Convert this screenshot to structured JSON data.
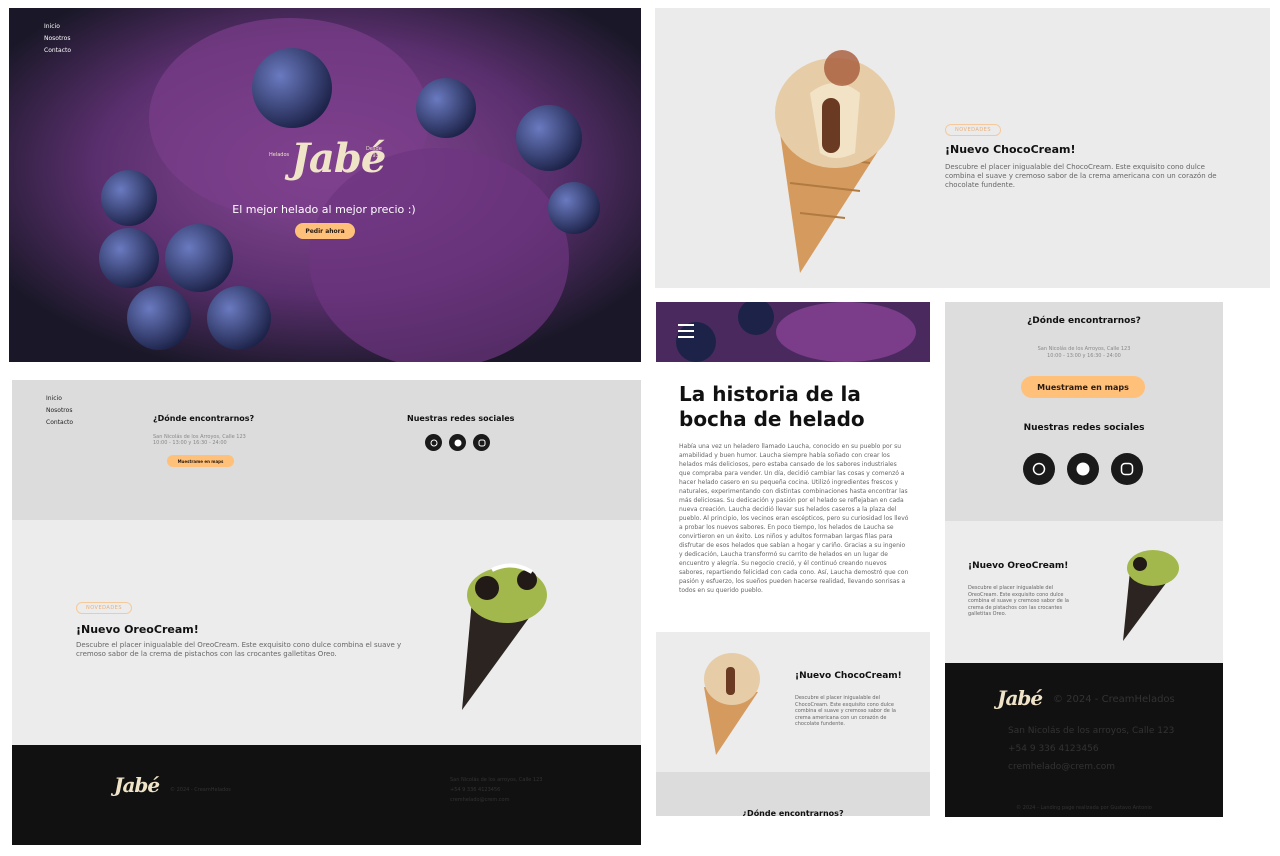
{
  "nav": {
    "inicio": "Inicio",
    "nosotros": "Nosotros",
    "contacto": "Contacto"
  },
  "hero": {
    "logo_left": "Helados",
    "logo": "Jabé",
    "logo_right_1": "Desde",
    "logo_right_2": "1993",
    "tagline": "El mejor helado al mejor precio :)",
    "cta": "Pedir ahora"
  },
  "choco": {
    "badge": "NOVEDADES",
    "title": "¡Nuevo ChocoCream!",
    "desc": "Descubre el placer inigualable del ChocoCream. Este exquisito cono dulce combina el suave y cremoso sabor de la crema americana con un corazón de chocolate fundente."
  },
  "oreo": {
    "badge": "NOVEDADES",
    "title": "¡Nuevo OreoCream!",
    "desc": "Descubre el placer inigualable del OreoCream. Este exquisito cono dulce combina el suave y cremoso sabor de la crema de pistachos con las crocantes galletitas Oreo."
  },
  "location": {
    "title": "¿Dónde encontrarnos?",
    "address": "San Nicolás de los Arroyos, Calle 123",
    "hours": "10:00 - 13:00 y 16:30 - 24:00",
    "button": "Muestrame en maps",
    "button_small": "Muestrame en maps"
  },
  "social": {
    "title": "Nuestras redes sociales"
  },
  "footer": {
    "copy": "© 2024 - CreamHelados",
    "address": "San Nicolás de los arroyos, Calle 123",
    "phone": "+54 9 336 4123456",
    "email": "cremhelado@crem.com",
    "credits": "© 2024 - Landing page realizada por Gustavo Antonio"
  },
  "story": {
    "title": "La historia de la bocha de helado",
    "body": "Había una vez un heladero llamado Laucha, conocido en su pueblo por su amabilidad y buen humor. Laucha siempre había soñado con crear los helados más deliciosos, pero estaba cansado de los sabores industriales que compraba para vender. Un día, decidió cambiar las cosas y comenzó a hacer helado casero en su pequeña cocina. Utilizó ingredientes frescos y naturales, experimentando con distintas combinaciones hasta encontrar las más deliciosas. Su dedicación y pasión por el helado se reflejaban en cada nueva creación. Laucha decidió llevar sus helados caseros a la plaza del pueblo. Al principio, los vecinos eran escépticos, pero su curiosidad los llevó a probar los nuevos sabores. En poco tiempo, los helados de Laucha se convirtieron en un éxito. Los niños y adultos formaban largas filas para disfrutar de esos helados que sabían a hogar y cariño. Gracias a su ingenio y dedicación, Laucha transformó su carrito de helados en un lugar de encuentro y alegría. Su negocio creció, y él continuó creando nuevos sabores, repartiendo felicidad con cada cono. Así, Laucha demostró que con pasión y esfuerzo, los sueños pueden hacerse realidad, llevando sonrisas a todos en su querido pueblo."
  },
  "colors": {
    "accent": "#ffc07a",
    "dark": "#111111",
    "gray": "#dddddd"
  }
}
